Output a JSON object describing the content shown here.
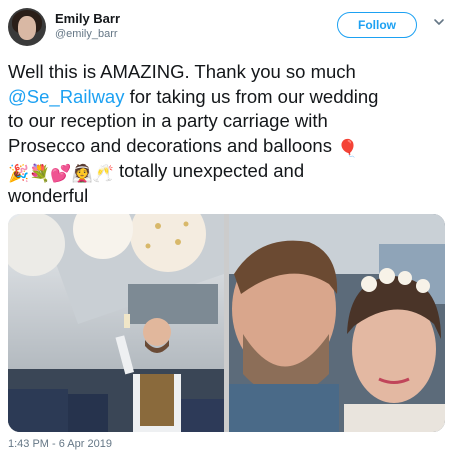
{
  "author": {
    "name": "Emily Barr",
    "handle": "@emily_barr"
  },
  "follow_label": "Follow",
  "tweet": {
    "line1": "Well this is AMAZING. Thank you so much",
    "mention": "@Se_Railway",
    "line2_rest": " for taking us from our wedding",
    "line3": "to our reception in a party carriage with",
    "line4": "Prosecco and decorations and balloons ",
    "emoji_balloon": "🎈",
    "emoji_row": "🎉💐💕👰🥂",
    "line5_rest": " totally unexpected and",
    "line6": "wonderful"
  },
  "media": {
    "photo_left": "man-raising-glass-in-train-carriage",
    "photo_right": "couple-selfie"
  },
  "timestamp": "1:43 PM - 6 Apr 2019",
  "icons": {
    "menu": "chevron-down-icon"
  },
  "colors": {
    "accent": "#1da1f2",
    "muted": "#657786",
    "text": "#14171a"
  }
}
